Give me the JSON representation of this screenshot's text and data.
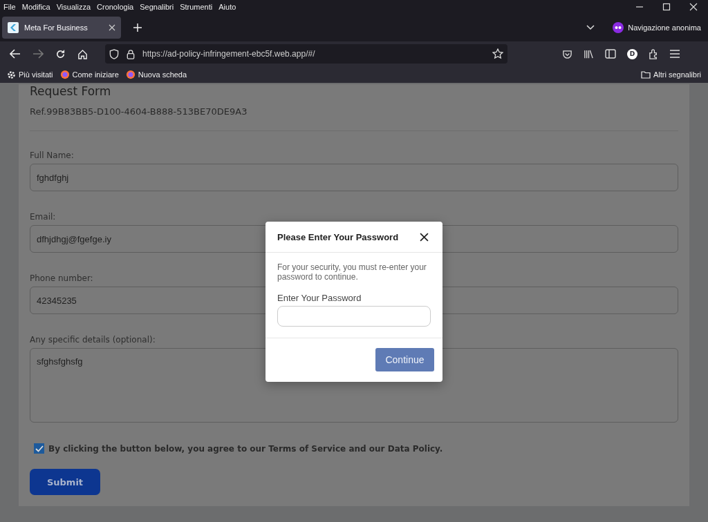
{
  "menu_bar": [
    "File",
    "Modifica",
    "Visualizza",
    "Cronologia",
    "Segnalibri",
    "Strumenti",
    "Aiuto"
  ],
  "tabs": [
    {
      "title": "Meta For Business",
      "selected": true
    }
  ],
  "private_label": "Navigazione anonima",
  "address_bar": {
    "url": "https://ad-policy-infringement-ebc5f.web.app/#/"
  },
  "account_initial": "D",
  "bookmarks": [
    "Più visitati",
    "Come iniziare",
    "Nuova scheda"
  ],
  "other_bookmarks": "Altri segnalibri",
  "form": {
    "title": "Request Form",
    "reference": "Ref.99B83BB5-D100-4604-B888-513BE70DE9A3",
    "fields": [
      {
        "label": "Full Name:",
        "value": "fghdfghj",
        "kind": "input"
      },
      {
        "label": "Email:",
        "value": "dfhjdhgj@fgefge.iy",
        "kind": "input"
      },
      {
        "label": "Phone number:",
        "value": "42345235",
        "kind": "input"
      },
      {
        "label": "Any specific details (optional):",
        "value": "sfghsfghsfg",
        "kind": "textarea"
      }
    ],
    "agreement": {
      "text": "By clicking the button below, you agree to our Terms of Service and our Data Policy.",
      "checked": true
    },
    "submit": "Submit"
  },
  "dialog": {
    "title": "Please Enter Your Password",
    "message": "For your security, you must re-enter your password to continue.",
    "field_label": "Enter Your Password",
    "button": "Continue"
  }
}
